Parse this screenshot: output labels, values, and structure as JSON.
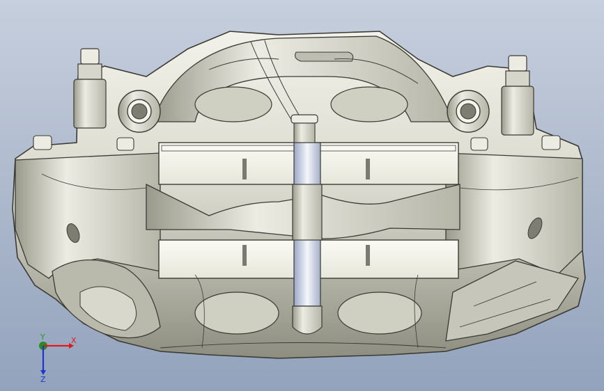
{
  "view": {
    "background_top": "#c6cfdd",
    "background_bottom": "#93a3bd",
    "model_fill": "#d9d9cf",
    "model_edge": "#3a3a34",
    "model_name": "brake-caliper"
  },
  "triad": {
    "x_label": "X",
    "y_label": "Y",
    "z_label": "Z",
    "x_color": "#e01818",
    "y_color": "#19a319",
    "z_color": "#1c36c8"
  }
}
